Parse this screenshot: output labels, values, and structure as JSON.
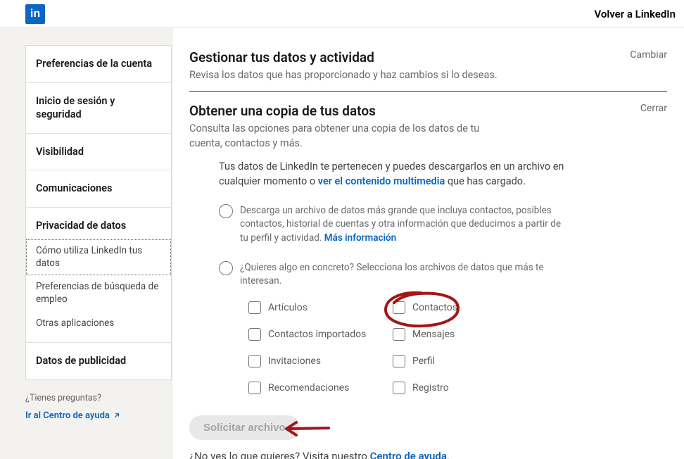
{
  "header": {
    "back_label": "Volver a LinkedIn"
  },
  "sidebar": {
    "items": [
      "Preferencias de la cuenta",
      "Inicio de sesión y seguridad",
      "Visibilidad",
      "Comunicaciones",
      "Privacidad de datos",
      "Datos de publicidad"
    ],
    "sub_items": [
      "Cómo utiliza LinkedIn tus datos",
      "Preferencias de búsqueda de empleo",
      "Otras aplicaciones"
    ],
    "help_question": "¿Tienes preguntas?",
    "help_link": "Ir al Centro de ayuda"
  },
  "sections": {
    "manage": {
      "title": "Gestionar tus datos y actividad",
      "subtitle": "Revisa los datos que has proporcionado y haz cambios si lo deseas.",
      "action": "Cambiar"
    },
    "copy": {
      "title": "Obtener una copia de tus datos",
      "subtitle": "Consulta las opciones para obtener una copia de los datos de tu cuenta, contactos y más.",
      "action": "Cerrar",
      "intro_pre": "Tus datos de LinkedIn te pertenecen y puedes descargarlos en un archivo en cualquier momento o ",
      "intro_link": "ver el contenido multimedia",
      "intro_post": " que has cargado.",
      "option1_pre": "Descarga un archivo de datos más grande que incluya contactos, posibles contactos, historial de cuentas y otra información que deducimos a partir de tu perfil y actividad. ",
      "option1_link": "Más información",
      "option2": "¿Quieres algo en concreto? Selecciona los archivos de datos que más te interesan.",
      "checkboxes": [
        "Artículos",
        "Contactos",
        "Contactos importados",
        "Mensajes",
        "Invitaciones",
        "Perfil",
        "Recomendaciones",
        "Registro"
      ],
      "button": "Solicitar archivo",
      "footer_pre": "¿No ves lo que quieres? Visita nuestro ",
      "footer_link": "Centro de ayuda",
      "footer_post": "."
    }
  }
}
